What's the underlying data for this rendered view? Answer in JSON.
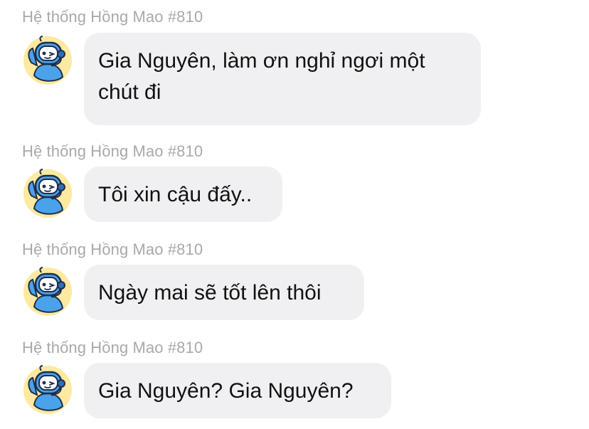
{
  "chat": {
    "messages": [
      {
        "sender": "Hệ thống Hồng Mao #810",
        "avatar_icon": "robot-mascot-icon",
        "text": "Gia Nguyên, làm ơn nghỉ ngơi một chút đi"
      },
      {
        "sender": "Hệ thống Hồng Mao #810",
        "avatar_icon": "robot-mascot-icon",
        "text": "Tôi xin cậu đấy.."
      },
      {
        "sender": "Hệ thống Hồng Mao #810",
        "avatar_icon": "robot-mascot-icon",
        "text": "Ngày mai sẽ tốt lên thôi"
      },
      {
        "sender": "Hệ thống Hồng Mao #810",
        "avatar_icon": "robot-mascot-icon",
        "text": "Gia Nguyên? Gia Nguyên?"
      }
    ]
  },
  "colors": {
    "bubble": "#f0f0f2",
    "sender_name": "#a9a9ad",
    "robot_blue": "#4aa3ea",
    "avatar_bg": "#fde9a0"
  }
}
